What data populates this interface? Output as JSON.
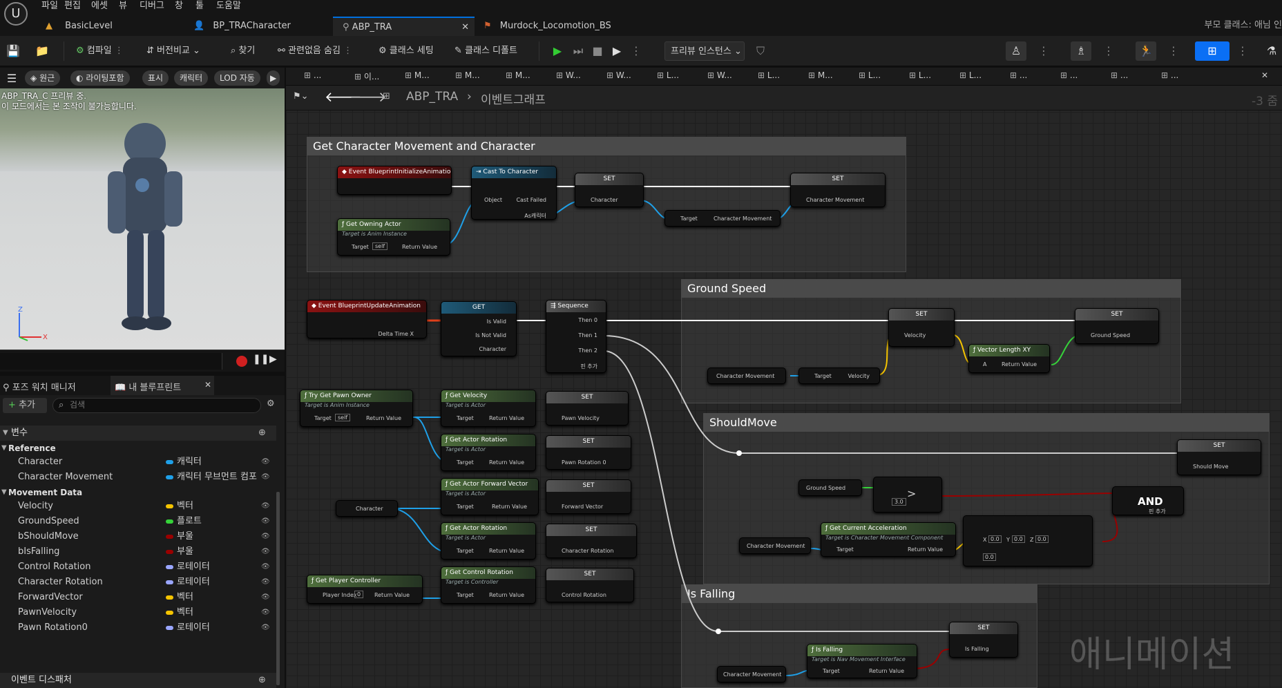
{
  "menu": [
    "파일",
    "편집",
    "에셋",
    "뷰",
    "디버그",
    "창",
    "툴",
    "도움말"
  ],
  "tabs": [
    {
      "label": "BasicLevel"
    },
    {
      "label": "BP_TRACharacter"
    },
    {
      "label": "ABP_TRA",
      "active": true
    },
    {
      "label": "Murdock_Locomotion_BS"
    }
  ],
  "parent_class_label": "부모 클래스: 애님 인",
  "toolbar": {
    "compile": "컴파일",
    "diff": "버전비교",
    "find": "찾기",
    "hide_unrelated": "관련없음 숨김",
    "class_settings": "클래스 세팅",
    "class_defaults": "클래스 디폴트",
    "preview_instance": "프리뷰 인스턴스"
  },
  "viewport": {
    "pills": [
      "원근",
      "라이팅포함",
      "표시",
      "캐릭터",
      "LOD 자동"
    ],
    "note_line1": "ABP_TRA_C 프리뷰 중.",
    "note_line2": "이 모드에서는 본 조작이 불가능합니다."
  },
  "panels": {
    "pose_watch": "포즈 워치 매니저",
    "my_blueprint": "내 블루프린트",
    "add": "추가",
    "search_placeholder": "검색",
    "variables": "변수",
    "event_dispatchers": "이벤트 디스패처"
  },
  "variables": {
    "categories": [
      {
        "name": "Reference",
        "items": [
          {
            "name": "Character",
            "type": "캐릭터",
            "color": "#1fa0e8"
          },
          {
            "name": "Character Movement",
            "type": "캐릭터 무브먼트 컴포",
            "color": "#1fa0e8"
          }
        ]
      },
      {
        "name": "Movement Data",
        "items": [
          {
            "name": "Velocity",
            "type": "벡터",
            "color": "#f5c400"
          },
          {
            "name": "GroundSpeed",
            "type": "플로트",
            "color": "#36d23a"
          },
          {
            "name": "bShouldMove",
            "type": "부울",
            "color": "#9a0000"
          },
          {
            "name": "bIsFalling",
            "type": "부울",
            "color": "#9a0000"
          },
          {
            "name": "Control Rotation",
            "type": "로테이터",
            "color": "#9aa6ff"
          },
          {
            "name": "Character Rotation",
            "type": "로테이터",
            "color": "#9aa6ff"
          },
          {
            "name": "ForwardVector",
            "type": "벡터",
            "color": "#f5c400"
          },
          {
            "name": "PawnVelocity",
            "type": "벡터",
            "color": "#f5c400"
          },
          {
            "name": "Pawn Rotation0",
            "type": "로테이터",
            "color": "#9aa6ff"
          }
        ]
      }
    ]
  },
  "graph": {
    "tabs": [
      "...",
      "이...",
      "M...",
      "M...",
      "M...",
      "W...",
      "W...",
      "L...",
      "W...",
      "L...",
      "M...",
      "L...",
      "L...",
      "L...",
      "...",
      "...",
      "...",
      "..."
    ],
    "breadcrumb_bp": "ABP_TRA",
    "breadcrumb_graph": "이벤트그래프",
    "zoom": "-3 줌",
    "comments": {
      "c1": "Get Character Movement and Character",
      "c2": "Ground Speed",
      "c3": "ShouldMove",
      "c4": "Is Falling"
    },
    "nodes": {
      "init_event": "Event BlueprintInitializeAnimation",
      "cast": "Cast To Character",
      "cast_object": "Object",
      "cast_failed": "Cast Failed",
      "cast_as": "As캐릭터",
      "set": "SET",
      "get": "GET",
      "character": "Character",
      "character_movement": "Character Movement",
      "target": "Target",
      "self": "self",
      "return_value": "Return Value",
      "get_owning_actor": "Get Owning Actor",
      "target_is_anim": "Target is Anim Instance",
      "target_is_actor": "Target is Actor",
      "target_is_controller": "Target is Controller",
      "target_is_cmc": "Target is Character Movement Component",
      "target_is_nav": "Target is Nav Movement Interface",
      "update_event": "Event BlueprintUpdateAnimation",
      "delta_time": "Delta Time X",
      "is_valid": "Is Valid",
      "is_not_valid": "Is Not Valid",
      "sequence": "Sequence",
      "then0": "Then 0",
      "then1": "Then 1",
      "then2": "Then 2",
      "add_pin": "핀 추가",
      "velocity": "Velocity",
      "vector_length_xy": "Vector Length XY",
      "a": "A",
      "ground_speed": "Ground Speed",
      "try_get_pawn_owner": "Try Get Pawn Owner",
      "get_velocity": "Get Velocity",
      "pawn_velocity": "Pawn Velocity",
      "get_actor_rotation": "Get Actor Rotation",
      "pawn_rotation": "Pawn Rotation 0",
      "get_actor_forward": "Get Actor Forward Vector",
      "forward_vector": "Forward Vector",
      "character_rotation": "Character Rotation",
      "get_player_controller": "Get Player Controller",
      "player_index": "Player Index",
      "player_index_val": "0",
      "get_control_rotation": "Get Control Rotation",
      "control_rotation": "Control Rotation",
      "should_move": "Should Move",
      "gt": ">",
      "gt_val": "3.0",
      "and": "AND",
      "get_current_accel": "Get Current Acceleration",
      "x": "X",
      "y": "Y",
      "z": "Z",
      "vec_x": "0.0",
      "vec_y": "0.0",
      "vec_z": "0.0",
      "tol": "0.0",
      "is_falling": "Is Falling",
      "is_falling_fn": "Is Falling"
    }
  },
  "watermark": "애니메이션"
}
